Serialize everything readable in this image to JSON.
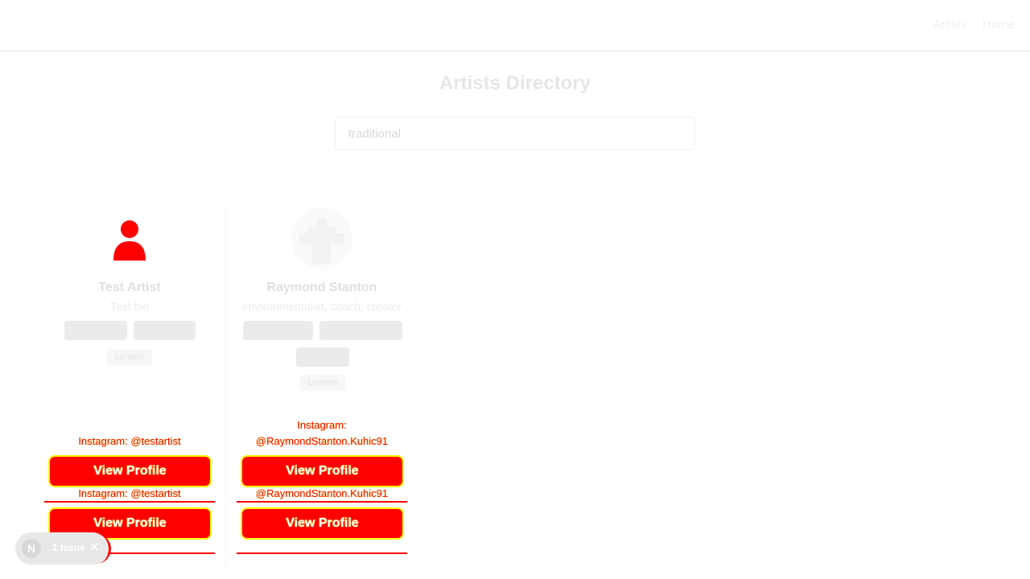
{
  "nav": {
    "artists": "Artists",
    "home": "Home"
  },
  "page": {
    "title": "Artists Directory"
  },
  "search": {
    "value": "traditional"
  },
  "cards": [
    {
      "name": "Test Artist",
      "bio": "Test bio",
      "location": "London",
      "instagram": "Instagram: @testartist",
      "button": "View Profile"
    },
    {
      "name": "Raymond Stanton",
      "bio": "environmentalist, coach, creator",
      "location": "London",
      "instagram_line1": "Instagram:",
      "instagram_line2": "@RaymondStanton.Kuhic91",
      "button": "View Profile"
    }
  ],
  "issues": {
    "logo": "N",
    "label": "1 Issue",
    "close": "✕"
  },
  "colors": {
    "highlight_red": "#ff0000",
    "highlight_yellow": "#ffff00"
  }
}
